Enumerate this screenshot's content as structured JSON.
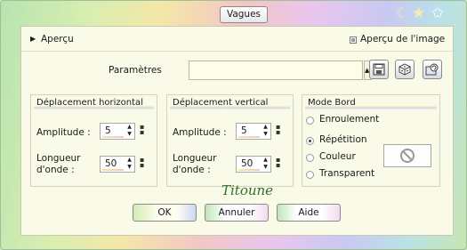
{
  "window": {
    "title": "Vagues"
  },
  "preview": {
    "toggle_label": "Aperçu",
    "image_preview_label": "Aperçu de l'image",
    "image_preview_checked": true
  },
  "params": {
    "label": "Paramètres",
    "preset_value": ""
  },
  "horizontal": {
    "title": "Déplacement horizontal",
    "amplitude_label": "Amplitude :",
    "amplitude_value": "5",
    "wavelength_label_1": "Longueur",
    "wavelength_label_2": "d'onde :",
    "wavelength_value": "50"
  },
  "vertical": {
    "title": "Déplacement vertical",
    "amplitude_label": "Amplitude :",
    "amplitude_value": "5",
    "wavelength_label_1": "Longueur",
    "wavelength_label_2": "d'onde :",
    "wavelength_value": "50"
  },
  "edge_mode": {
    "title": "Mode Bord",
    "options": [
      "Enroulement",
      "Répétition",
      "Couleur",
      "Transparent"
    ],
    "selected": "Répétition"
  },
  "signature": "Titoune",
  "buttons": {
    "ok": "OK",
    "cancel": "Annuler",
    "help": "Aide"
  },
  "icons": [
    "moon-icon",
    "star-icon",
    "star-outline-icon",
    "save-preset-icon",
    "random-dice-icon",
    "reset-preset-icon",
    "no-color-icon",
    "spin-up-icon",
    "spin-down-icon"
  ]
}
